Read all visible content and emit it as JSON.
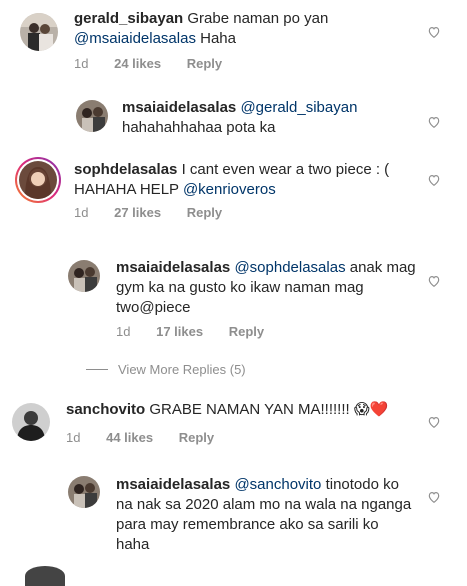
{
  "comments": [
    {
      "username": "gerald_sibayan",
      "text": "Grabe naman po yan",
      "mention": "@msaiaidelasalas",
      "text_after": "Haha",
      "time": "1d",
      "likes": "24 likes",
      "reply": "Reply"
    },
    {
      "username": "msaiaidelasalas",
      "mention": "@gerald_sibayan",
      "text": "hahahahhahaa pota ka"
    },
    {
      "username": "sophdelasalas",
      "text": "I cant even wear a two piece : ( HAHAHA HELP",
      "mention": "@kenrioveros",
      "time": "1d",
      "likes": "27 likes",
      "reply": "Reply"
    },
    {
      "username": "msaiaidelasalas",
      "mention": "@sophdelasalas",
      "text": "anak mag gym ka na gusto ko ikaw naman mag two@piece",
      "time": "1d",
      "likes": "17 likes",
      "reply": "Reply"
    },
    {
      "username": "sanchovito",
      "text": "GRABE NAMAN YAN MA!!!!!!!",
      "emoji": "😱❤️",
      "time": "1d",
      "likes": "44 likes",
      "reply": "Reply"
    },
    {
      "username": "msaiaidelasalas",
      "mention": "@sanchovito",
      "text": "tinotodo ko na nak sa 2020 alam mo na wala na nganga para may remembrance ako sa sarili ko haha"
    }
  ],
  "view_more": "View More Replies (5)",
  "colors": {
    "mention": "#003569",
    "meta": "#8e8e8e",
    "text": "#262626",
    "story_ring": "#d6249f"
  }
}
